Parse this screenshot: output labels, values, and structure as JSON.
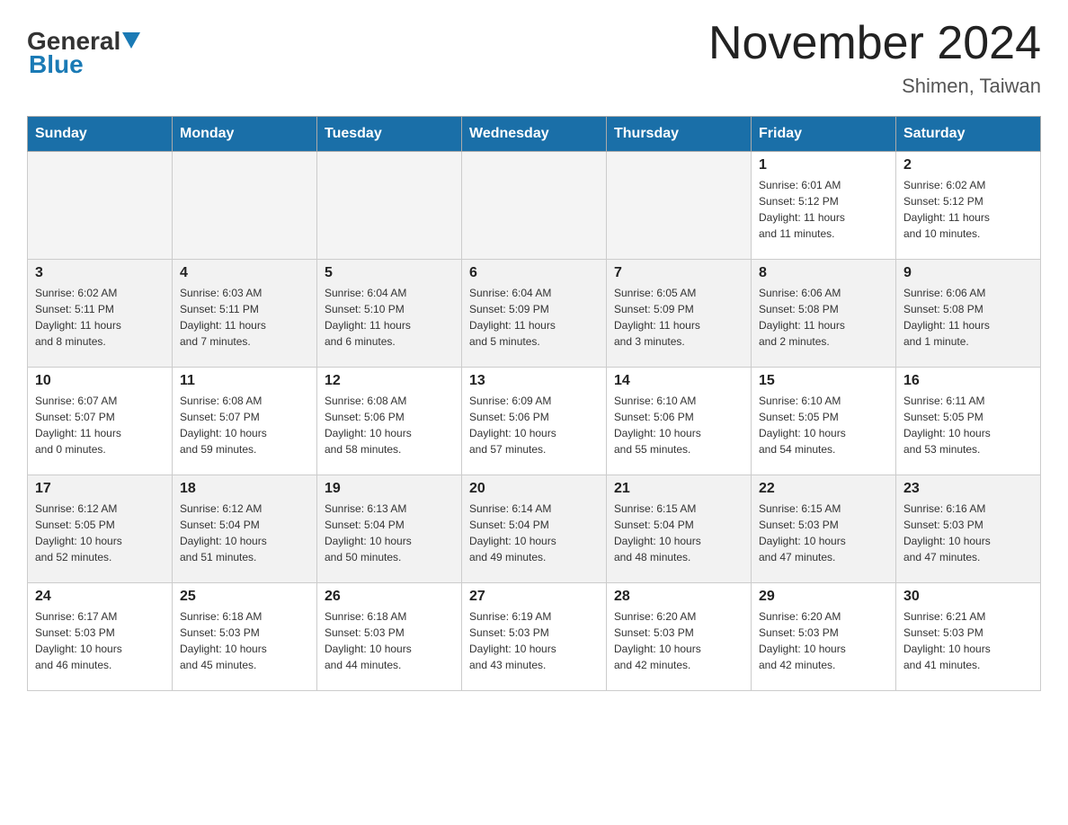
{
  "header": {
    "logo_general": "General",
    "logo_blue": "Blue",
    "title": "November 2024",
    "subtitle": "Shimen, Taiwan"
  },
  "calendar": {
    "days_of_week": [
      "Sunday",
      "Monday",
      "Tuesday",
      "Wednesday",
      "Thursday",
      "Friday",
      "Saturday"
    ],
    "weeks": [
      [
        {
          "day": "",
          "info": ""
        },
        {
          "day": "",
          "info": ""
        },
        {
          "day": "",
          "info": ""
        },
        {
          "day": "",
          "info": ""
        },
        {
          "day": "",
          "info": ""
        },
        {
          "day": "1",
          "info": "Sunrise: 6:01 AM\nSunset: 5:12 PM\nDaylight: 11 hours\nand 11 minutes."
        },
        {
          "day": "2",
          "info": "Sunrise: 6:02 AM\nSunset: 5:12 PM\nDaylight: 11 hours\nand 10 minutes."
        }
      ],
      [
        {
          "day": "3",
          "info": "Sunrise: 6:02 AM\nSunset: 5:11 PM\nDaylight: 11 hours\nand 8 minutes."
        },
        {
          "day": "4",
          "info": "Sunrise: 6:03 AM\nSunset: 5:11 PM\nDaylight: 11 hours\nand 7 minutes."
        },
        {
          "day": "5",
          "info": "Sunrise: 6:04 AM\nSunset: 5:10 PM\nDaylight: 11 hours\nand 6 minutes."
        },
        {
          "day": "6",
          "info": "Sunrise: 6:04 AM\nSunset: 5:09 PM\nDaylight: 11 hours\nand 5 minutes."
        },
        {
          "day": "7",
          "info": "Sunrise: 6:05 AM\nSunset: 5:09 PM\nDaylight: 11 hours\nand 3 minutes."
        },
        {
          "day": "8",
          "info": "Sunrise: 6:06 AM\nSunset: 5:08 PM\nDaylight: 11 hours\nand 2 minutes."
        },
        {
          "day": "9",
          "info": "Sunrise: 6:06 AM\nSunset: 5:08 PM\nDaylight: 11 hours\nand 1 minute."
        }
      ],
      [
        {
          "day": "10",
          "info": "Sunrise: 6:07 AM\nSunset: 5:07 PM\nDaylight: 11 hours\nand 0 minutes."
        },
        {
          "day": "11",
          "info": "Sunrise: 6:08 AM\nSunset: 5:07 PM\nDaylight: 10 hours\nand 59 minutes."
        },
        {
          "day": "12",
          "info": "Sunrise: 6:08 AM\nSunset: 5:06 PM\nDaylight: 10 hours\nand 58 minutes."
        },
        {
          "day": "13",
          "info": "Sunrise: 6:09 AM\nSunset: 5:06 PM\nDaylight: 10 hours\nand 57 minutes."
        },
        {
          "day": "14",
          "info": "Sunrise: 6:10 AM\nSunset: 5:06 PM\nDaylight: 10 hours\nand 55 minutes."
        },
        {
          "day": "15",
          "info": "Sunrise: 6:10 AM\nSunset: 5:05 PM\nDaylight: 10 hours\nand 54 minutes."
        },
        {
          "day": "16",
          "info": "Sunrise: 6:11 AM\nSunset: 5:05 PM\nDaylight: 10 hours\nand 53 minutes."
        }
      ],
      [
        {
          "day": "17",
          "info": "Sunrise: 6:12 AM\nSunset: 5:05 PM\nDaylight: 10 hours\nand 52 minutes."
        },
        {
          "day": "18",
          "info": "Sunrise: 6:12 AM\nSunset: 5:04 PM\nDaylight: 10 hours\nand 51 minutes."
        },
        {
          "day": "19",
          "info": "Sunrise: 6:13 AM\nSunset: 5:04 PM\nDaylight: 10 hours\nand 50 minutes."
        },
        {
          "day": "20",
          "info": "Sunrise: 6:14 AM\nSunset: 5:04 PM\nDaylight: 10 hours\nand 49 minutes."
        },
        {
          "day": "21",
          "info": "Sunrise: 6:15 AM\nSunset: 5:04 PM\nDaylight: 10 hours\nand 48 minutes."
        },
        {
          "day": "22",
          "info": "Sunrise: 6:15 AM\nSunset: 5:03 PM\nDaylight: 10 hours\nand 47 minutes."
        },
        {
          "day": "23",
          "info": "Sunrise: 6:16 AM\nSunset: 5:03 PM\nDaylight: 10 hours\nand 47 minutes."
        }
      ],
      [
        {
          "day": "24",
          "info": "Sunrise: 6:17 AM\nSunset: 5:03 PM\nDaylight: 10 hours\nand 46 minutes."
        },
        {
          "day": "25",
          "info": "Sunrise: 6:18 AM\nSunset: 5:03 PM\nDaylight: 10 hours\nand 45 minutes."
        },
        {
          "day": "26",
          "info": "Sunrise: 6:18 AM\nSunset: 5:03 PM\nDaylight: 10 hours\nand 44 minutes."
        },
        {
          "day": "27",
          "info": "Sunrise: 6:19 AM\nSunset: 5:03 PM\nDaylight: 10 hours\nand 43 minutes."
        },
        {
          "day": "28",
          "info": "Sunrise: 6:20 AM\nSunset: 5:03 PM\nDaylight: 10 hours\nand 42 minutes."
        },
        {
          "day": "29",
          "info": "Sunrise: 6:20 AM\nSunset: 5:03 PM\nDaylight: 10 hours\nand 42 minutes."
        },
        {
          "day": "30",
          "info": "Sunrise: 6:21 AM\nSunset: 5:03 PM\nDaylight: 10 hours\nand 41 minutes."
        }
      ]
    ]
  }
}
